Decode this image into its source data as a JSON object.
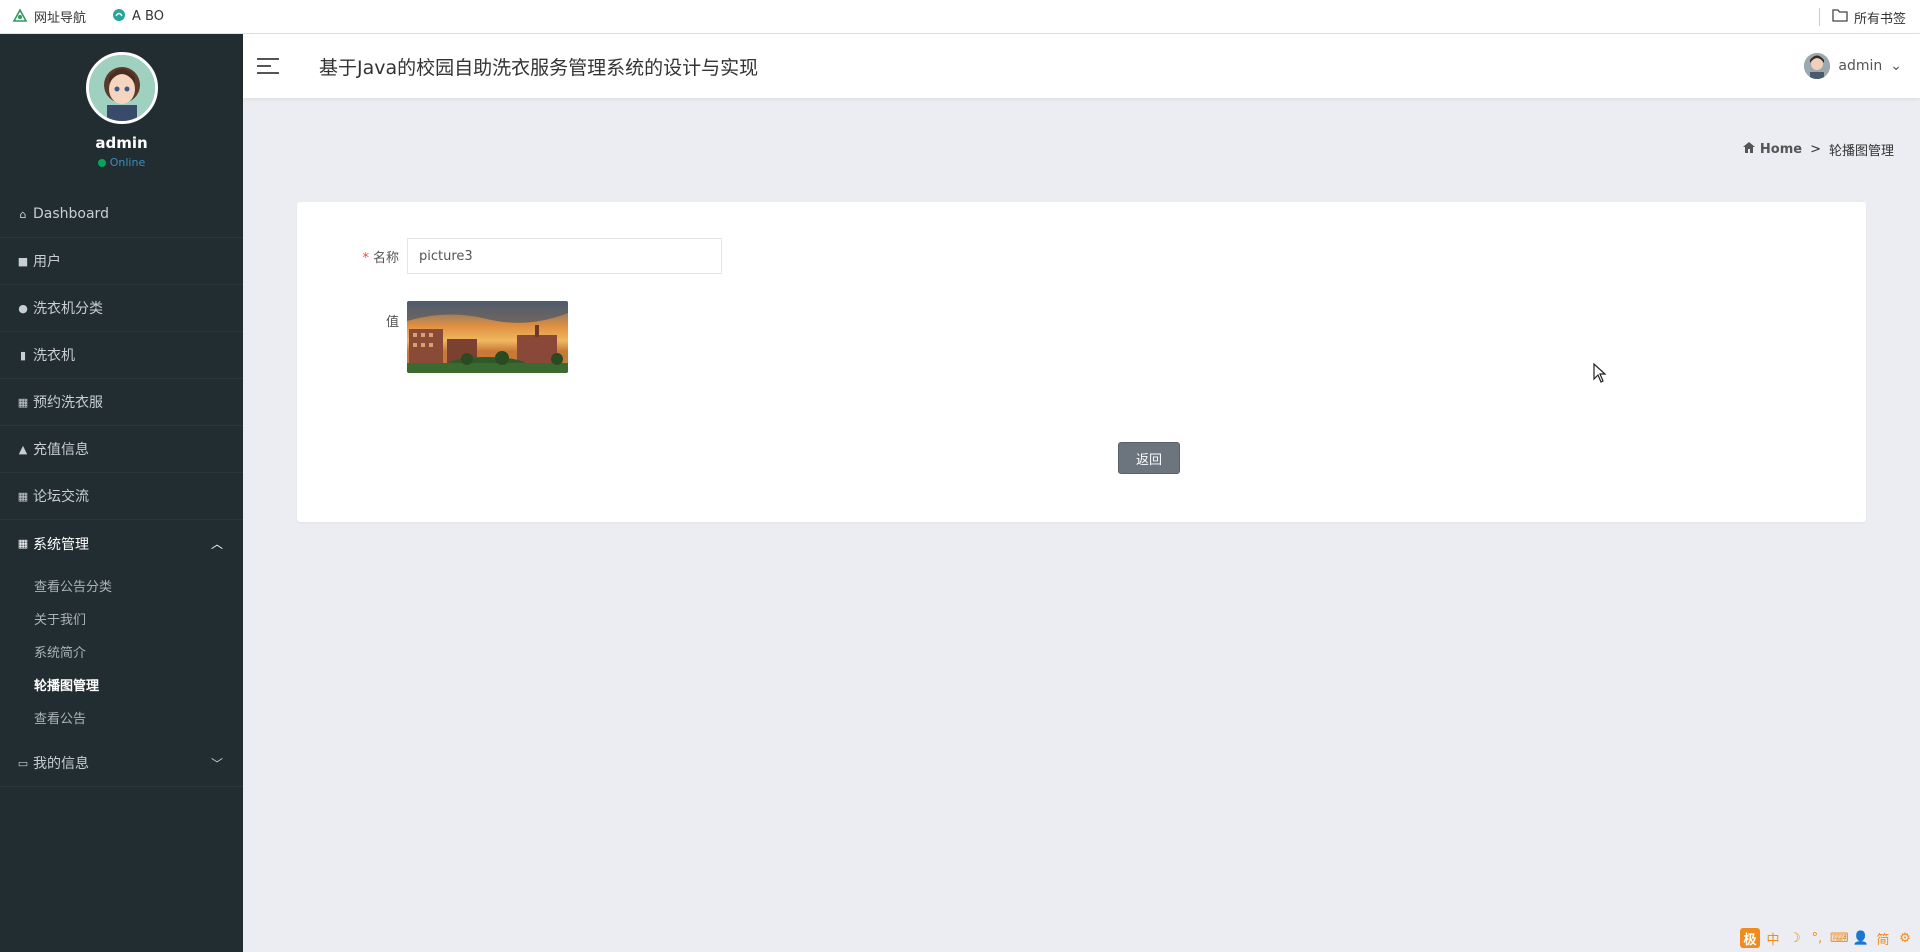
{
  "bookmarks": {
    "items": [
      {
        "label": "网址导航",
        "icon": "nav-icon"
      },
      {
        "label": "A BO",
        "icon": "bookmark-icon"
      }
    ],
    "all_bookmarks_label": "所有书签"
  },
  "sidebar": {
    "user": {
      "name": "admin",
      "status": "Online"
    },
    "items": [
      {
        "label": "Dashboard",
        "icon": "home-icon"
      },
      {
        "label": "用户",
        "icon": "user-icon"
      },
      {
        "label": "洗衣机分类",
        "icon": "pin-icon"
      },
      {
        "label": "洗衣机",
        "icon": "chart-icon"
      },
      {
        "label": "预约洗衣服",
        "icon": "grid-icon"
      },
      {
        "label": "充值信息",
        "icon": "lock-icon"
      },
      {
        "label": "论坛交流",
        "icon": "grid-icon"
      },
      {
        "label": "系统管理",
        "icon": "grid-icon",
        "expanded": true
      },
      {
        "label": "我的信息",
        "icon": "card-icon",
        "expanded": false
      }
    ],
    "system_submenu": [
      "查看公告分类",
      "关于我们",
      "系统简介",
      "轮播图管理",
      "查看公告"
    ],
    "current_submenu": "轮播图管理"
  },
  "header": {
    "title": "基于Java的校园自助洗衣服务管理系统的设计与实现",
    "user": "admin"
  },
  "breadcrumb": {
    "home": "Home",
    "separator": ">",
    "current": "轮播图管理"
  },
  "form": {
    "name_label": "名称",
    "name_value": "picture3",
    "value_label": "值",
    "back_button": "返回"
  },
  "ime": {
    "logo": "极",
    "buttons": [
      "中",
      "☽",
      "°,",
      "⌨",
      "👤",
      "简",
      "⚙"
    ]
  },
  "colors": {
    "sidebar_bg": "#222d32",
    "status_online": "#00a65a",
    "back_button": "#6c757d",
    "ime_accent": "#f08c1e"
  }
}
